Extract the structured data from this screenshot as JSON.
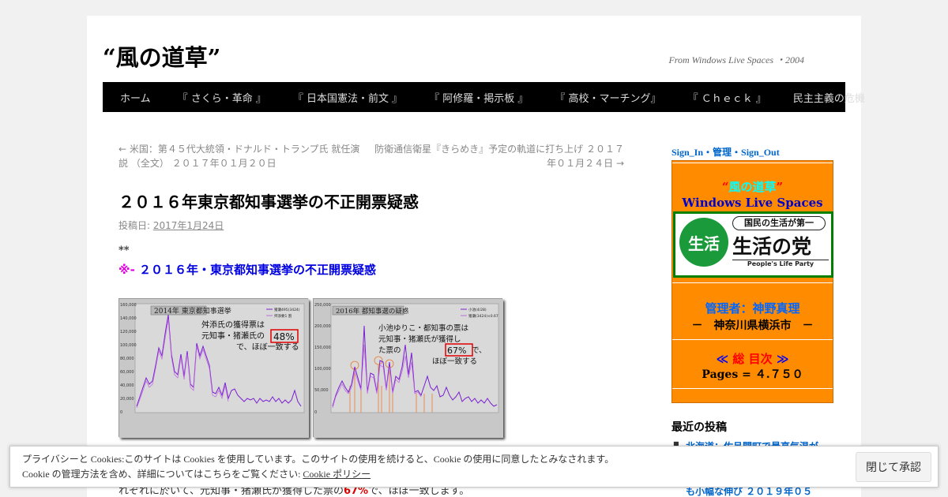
{
  "site": {
    "title": "“風の道草”",
    "description": "From Windows Live Spaces ・2004"
  },
  "nav": {
    "items": [
      "ホーム",
      "『 さくら・革命 』",
      "『 日本国憲法・前文 』",
      "『 阿修羅・掲示板 』",
      "『 高校・マーチング』",
      "『 Ｃｈｅｃｋ 』",
      "民主主義の危機"
    ]
  },
  "post_nav": {
    "prev": "← 米国：第４５代大統領・ドナルド・トランプ氏 就任演説 （全文） ２０１７年０１月２０日",
    "next": "防衛通信衛星『きらめき』予定の軌道に打ち上げ ２０１７年０１月２４日 →"
  },
  "post": {
    "title": "２０１６年東京都知事選挙の不正開票疑惑",
    "meta_label": "投稿日: ",
    "meta_date": "2017年1月24日",
    "asterisks": "**",
    "subhead_mark": "※- ",
    "subhead": "２０１６年・東京都知事選挙の不正開票疑惑"
  },
  "images": [
    {
      "title": "2014年 東京都知事選挙",
      "legend": [
        "猪瀬495(3424)",
        "舛添要1 割"
      ],
      "caption_lines": [
        "舛添氏の獲得票は",
        "元知事・猪瀬氏の",
        "で、ほぼ一致する"
      ],
      "highlight": "48%",
      "y_ticks": [
        "160,000",
        "140,000",
        "120,000",
        "100,000",
        "80,000",
        "60,000",
        "40,000",
        "20,000",
        "0"
      ]
    },
    {
      "title": "2016年 都知事選の疑惑",
      "legend": [
        "小池(4/28)",
        "猪瀬(3424)×0.67"
      ],
      "caption_lines": [
        "小池ゆりこ・都知事の票は",
        "元知事・猪瀬氏が獲得し",
        "た票の",
        "で、",
        "ほぼ一致する"
      ],
      "highlight": "67%",
      "y_ticks": [
        "250,000",
        "200,000",
        "150,000",
        "100,000",
        "50,000",
        "0"
      ]
    }
  ],
  "sidebar": {
    "link": "Sign_In・管理・Sign_Out",
    "panel": {
      "title_quote_open": "“",
      "title": "風の道草",
      "title_quote_close": "”",
      "subtitle": "Windows Live Spaces",
      "logo_circle": "生活",
      "logo_top": "国民の生活が第一",
      "logo_main": "生活の党",
      "logo_sub": "People's Life Party",
      "admin": "管理者：神野真理",
      "location": "－　神奈川県横浜市　－",
      "toc_left": "≪ ",
      "toc": "総 目次",
      "toc_right": " ≫",
      "pages_label": "Pages = ",
      "pages_value": "４.７５０"
    },
    "recent_title": "最近の投稿",
    "recent_items": [
      "北海道：佐呂間町で最高気温が"
    ]
  },
  "behind": {
    "text_prefix": "れぞれに於いて、元知事・猪瀬氏が獲得した票の",
    "text_red": "67%",
    "text_suffix": "で、ほぼ一致します。",
    "side": "も小幅な伸び ２０１９年０５"
  },
  "cookie": {
    "line1": "プライバシーと Cookies:このサイトは Cookies を使用しています。このサイトの使用を続けると、Cookie の使用に同意したとみなされます。",
    "line2_prefix": "Cookie の管理方法を含め、詳細についてはこちらをご覧ください: ",
    "line2_link": "Cookie ポリシー",
    "button": "閉じて承認"
  },
  "colors": {
    "nav_bg": "#000000",
    "panel_bg": "#ff8c00",
    "link": "#0066cc",
    "subhead": "#0000e0",
    "series_purple": "#8a2be2",
    "highlight_red": "#e00000"
  }
}
